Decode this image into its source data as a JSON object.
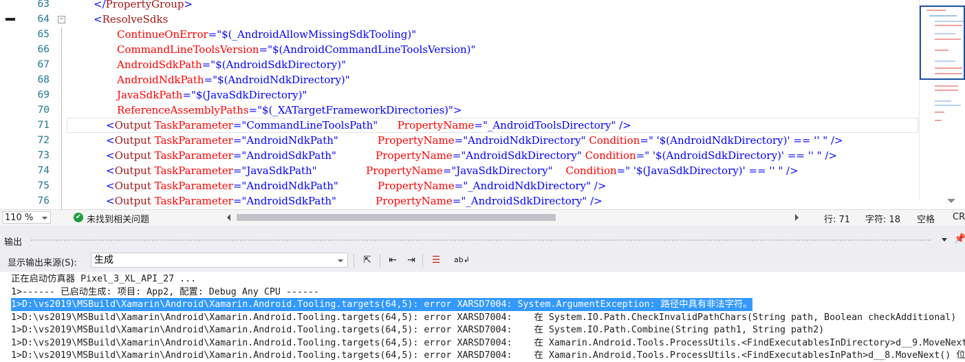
{
  "editor": {
    "lines": [
      {
        "num": "63",
        "indent": 136,
        "parts": [
          {
            "t": "</",
            "c": "br"
          },
          {
            "t": "PropertyGroup",
            "c": "tag"
          },
          {
            "t": ">",
            "c": "br"
          }
        ]
      },
      {
        "num": "64",
        "indent": 136,
        "parts": [
          {
            "t": "<",
            "c": "br"
          },
          {
            "t": "ResolveSdks",
            "c": "tag"
          }
        ]
      },
      {
        "num": "65",
        "indent": 170,
        "parts": [
          {
            "t": "ContinueOnError",
            "c": "attr"
          },
          {
            "t": "=\"",
            "c": "br"
          },
          {
            "t": "$(_AndroidAllowMissingSdkTooling)",
            "c": "val"
          },
          {
            "t": "\"",
            "c": "br"
          }
        ]
      },
      {
        "num": "66",
        "indent": 170,
        "parts": [
          {
            "t": "CommandLineToolsVersion",
            "c": "attr"
          },
          {
            "t": "=\"",
            "c": "br"
          },
          {
            "t": "$(AndroidCommandLineToolsVersion)",
            "c": "val"
          },
          {
            "t": "\"",
            "c": "br"
          }
        ]
      },
      {
        "num": "67",
        "indent": 170,
        "parts": [
          {
            "t": "AndroidSdkPath",
            "c": "attr"
          },
          {
            "t": "=\"",
            "c": "br"
          },
          {
            "t": "$(AndroidSdkDirectory)",
            "c": "val"
          },
          {
            "t": "\"",
            "c": "br"
          }
        ]
      },
      {
        "num": "68",
        "indent": 170,
        "parts": [
          {
            "t": "AndroidNdkPath",
            "c": "attr"
          },
          {
            "t": "=\"",
            "c": "br"
          },
          {
            "t": "$(AndroidNdkDirectory)",
            "c": "val"
          },
          {
            "t": "\"",
            "c": "br"
          }
        ]
      },
      {
        "num": "69",
        "indent": 170,
        "parts": [
          {
            "t": "JavaSdkPath",
            "c": "attr"
          },
          {
            "t": "=\"",
            "c": "br"
          },
          {
            "t": "$(JavaSdkDirectory)",
            "c": "val"
          },
          {
            "t": "\"",
            "c": "br"
          }
        ]
      },
      {
        "num": "70",
        "indent": 170,
        "parts": [
          {
            "t": "ReferenceAssemblyPaths",
            "c": "attr"
          },
          {
            "t": "=\"",
            "c": "br"
          },
          {
            "t": "$(_XATargetFrameworkDirectories)",
            "c": "val"
          },
          {
            "t": "\">",
            "c": "br"
          }
        ]
      },
      {
        "num": "71",
        "indent": 154,
        "parts": [
          {
            "t": "<",
            "c": "br"
          },
          {
            "t": "Output",
            "c": "tag"
          },
          {
            "t": " TaskParameter",
            "c": "attr"
          },
          {
            "t": "=\"",
            "c": "br"
          },
          {
            "t": "CommandLineToolsPath",
            "c": "val"
          },
          {
            "t": "\"      ",
            "c": "br"
          },
          {
            "t": "PropertyName",
            "c": "attr"
          },
          {
            "t": "=\"",
            "c": "br"
          },
          {
            "t": "_AndroidToolsDirectory",
            "c": "val"
          },
          {
            "t": "\" />",
            "c": "br"
          }
        ]
      },
      {
        "num": "72",
        "indent": 154,
        "parts": [
          {
            "t": "<",
            "c": "br"
          },
          {
            "t": "Output",
            "c": "tag"
          },
          {
            "t": " TaskParameter",
            "c": "attr"
          },
          {
            "t": "=\"",
            "c": "br"
          },
          {
            "t": "AndroidNdkPath",
            "c": "val"
          },
          {
            "t": "\"            ",
            "c": "br"
          },
          {
            "t": "PropertyName",
            "c": "attr"
          },
          {
            "t": "=\"",
            "c": "br"
          },
          {
            "t": "AndroidNdkDirectory",
            "c": "val"
          },
          {
            "t": "\" ",
            "c": "br"
          },
          {
            "t": "Condition",
            "c": "attr"
          },
          {
            "t": "=\" ",
            "c": "br"
          },
          {
            "t": "'$(AndroidNdkDirectory)' == '' ",
            "c": "val"
          },
          {
            "t": "\" />",
            "c": "br"
          }
        ]
      },
      {
        "num": "73",
        "indent": 154,
        "parts": [
          {
            "t": "<",
            "c": "br"
          },
          {
            "t": "Output",
            "c": "tag"
          },
          {
            "t": " TaskParameter",
            "c": "attr"
          },
          {
            "t": "=\"",
            "c": "br"
          },
          {
            "t": "AndroidSdkPath",
            "c": "val"
          },
          {
            "t": "\"            ",
            "c": "br"
          },
          {
            "t": "PropertyName",
            "c": "attr"
          },
          {
            "t": "=\"",
            "c": "br"
          },
          {
            "t": "AndroidSdkDirectory",
            "c": "val"
          },
          {
            "t": "\" ",
            "c": "br"
          },
          {
            "t": "Condition",
            "c": "attr"
          },
          {
            "t": "=\" ",
            "c": "br"
          },
          {
            "t": "'$(AndroidSdkDirectory)' == '' ",
            "c": "val"
          },
          {
            "t": "\" />",
            "c": "br"
          }
        ]
      },
      {
        "num": "74",
        "indent": 154,
        "parts": [
          {
            "t": "<",
            "c": "br"
          },
          {
            "t": "Output",
            "c": "tag"
          },
          {
            "t": " TaskParameter",
            "c": "attr"
          },
          {
            "t": "=\"",
            "c": "br"
          },
          {
            "t": "JavaSdkPath",
            "c": "val"
          },
          {
            "t": "\"               ",
            "c": "br"
          },
          {
            "t": "PropertyName",
            "c": "attr"
          },
          {
            "t": "=\"",
            "c": "br"
          },
          {
            "t": "JavaSdkDirectory",
            "c": "val"
          },
          {
            "t": "\"    ",
            "c": "br"
          },
          {
            "t": "Condition",
            "c": "attr"
          },
          {
            "t": "=\" ",
            "c": "br"
          },
          {
            "t": "'$(JavaSdkDirectory)' == '' ",
            "c": "val"
          },
          {
            "t": "\" />",
            "c": "br"
          }
        ]
      },
      {
        "num": "75",
        "indent": 154,
        "parts": [
          {
            "t": "<",
            "c": "br"
          },
          {
            "t": "Output",
            "c": "tag"
          },
          {
            "t": " TaskParameter",
            "c": "attr"
          },
          {
            "t": "=\"",
            "c": "br"
          },
          {
            "t": "AndroidNdkPath",
            "c": "val"
          },
          {
            "t": "\"            ",
            "c": "br"
          },
          {
            "t": "PropertyName",
            "c": "attr"
          },
          {
            "t": "=\"",
            "c": "br"
          },
          {
            "t": "_AndroidNdkDirectory",
            "c": "val"
          },
          {
            "t": "\" />",
            "c": "br"
          }
        ]
      },
      {
        "num": "76",
        "indent": 154,
        "parts": [
          {
            "t": "<",
            "c": "br"
          },
          {
            "t": "Output",
            "c": "tag"
          },
          {
            "t": " TaskParameter",
            "c": "attr"
          },
          {
            "t": "=\"",
            "c": "br"
          },
          {
            "t": "AndroidSdkPath",
            "c": "val"
          },
          {
            "t": "\"            ",
            "c": "br"
          },
          {
            "t": "PropertyName",
            "c": "attr"
          },
          {
            "t": "=\"",
            "c": "br"
          },
          {
            "t": "_AndroidSdkDirectory",
            "c": "val"
          },
          {
            "t": "\" />",
            "c": "br"
          }
        ]
      }
    ],
    "fold_symbol": "−"
  },
  "status": {
    "zoom": "110 %",
    "issues": "未找到相关问题",
    "line": "行: 71",
    "char": "字符: 18",
    "whitespace": "空格",
    "eol": "CR"
  },
  "output": {
    "title": "输出",
    "source_label": "显示输出来源(S):",
    "source_value": "生成",
    "lines": [
      "正在启动仿真器 Pixel_3_XL_API_27 ...",
      "1>------ 已启动生成: 项目: App2, 配置: Debug Any CPU ------",
      "1>D:\\vs2019\\MSBuild\\Xamarin\\Android\\Xamarin.Android.Tooling.targets(64,5): error XARSD7004: System.ArgumentException: 路径中具有非法字符。",
      "1>D:\\vs2019\\MSBuild\\Xamarin\\Android\\Xamarin.Android.Tooling.targets(64,5): error XARSD7004:    在 System.IO.Path.CheckInvalidPathChars(String path, Boolean checkAdditional)",
      "1>D:\\vs2019\\MSBuild\\Xamarin\\Android\\Xamarin.Android.Tooling.targets(64,5): error XARSD7004:    在 System.IO.Path.Combine(String path1, String path2)",
      "1>D:\\vs2019\\MSBuild\\Xamarin\\Android\\Xamarin.Android.Tooling.targets(64,5): error XARSD7004:    在 Xamarin.Android.Tools.ProcessUtils.<FindExecutablesInDirectory>d__9.MoveNext",
      "1>D:\\vs2019\\MSBuild\\Xamarin\\Android\\Xamarin.Android.Tooling.targets(64,5): error XARSD7004:    在 Xamarin.Android.Tools.ProcessUtils.<FindExecutablesInPath>d__8.MoveNext() 位"
    ]
  },
  "colors": {
    "tag": "#a31515",
    "bracket": "#0000ff",
    "attr": "#ff0000",
    "value": "#0000ff",
    "selection": "#3399ff",
    "ok": "#1f9e40"
  }
}
